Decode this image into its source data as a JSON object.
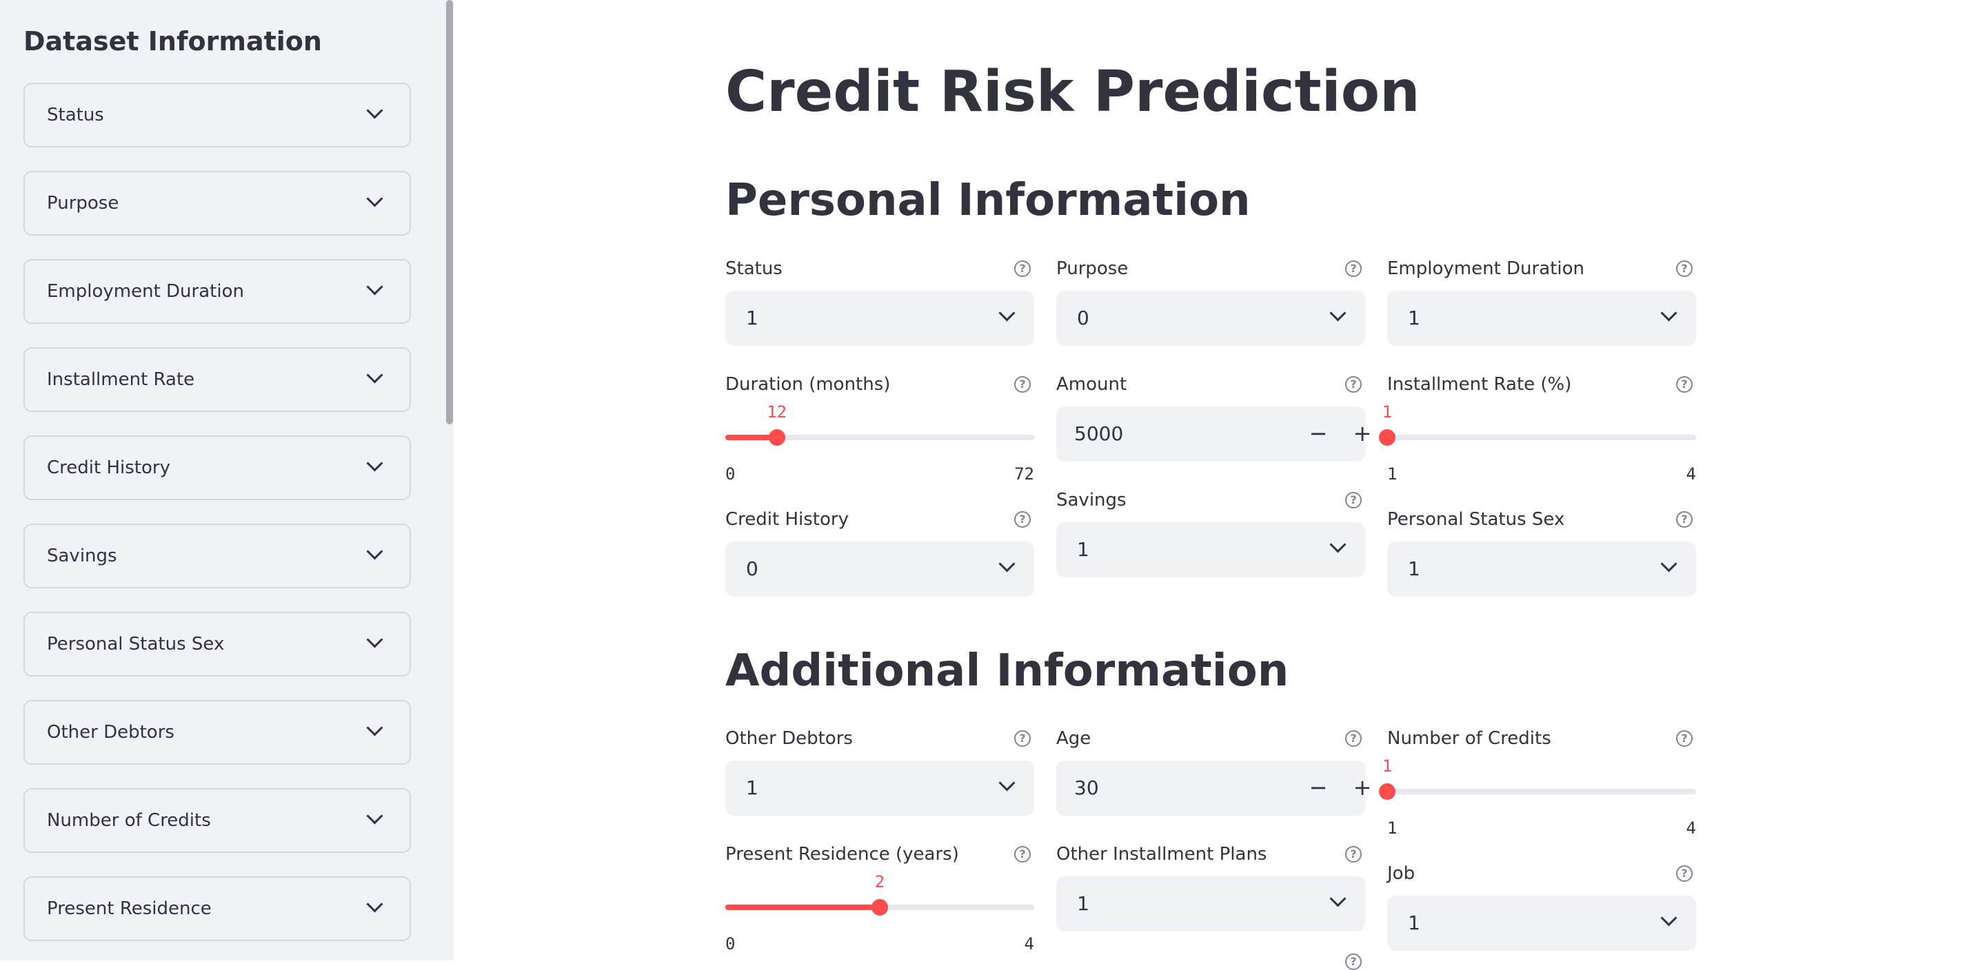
{
  "sidebar": {
    "title": "Dataset Information",
    "expanders": [
      {
        "label": "Status"
      },
      {
        "label": "Purpose"
      },
      {
        "label": "Employment Duration"
      },
      {
        "label": "Installment Rate"
      },
      {
        "label": "Credit History"
      },
      {
        "label": "Savings"
      },
      {
        "label": "Personal Status Sex"
      },
      {
        "label": "Other Debtors"
      },
      {
        "label": "Number of Credits"
      },
      {
        "label": "Present Residence"
      }
    ]
  },
  "main": {
    "title": "Credit Risk Prediction",
    "help_glyph": "?",
    "personal": {
      "heading": "Personal Information",
      "status": {
        "label": "Status",
        "value": "1"
      },
      "purpose": {
        "label": "Purpose",
        "value": "0"
      },
      "employment_duration": {
        "label": "Employment Duration",
        "value": "1"
      },
      "duration": {
        "label": "Duration (months)",
        "value": "12",
        "min": "0",
        "max": "72"
      },
      "amount": {
        "label": "Amount",
        "value": "5000",
        "minus": "−",
        "plus": "+"
      },
      "installment_rate": {
        "label": "Installment Rate (%)",
        "value": "1",
        "min": "1",
        "max": "4"
      },
      "credit_history": {
        "label": "Credit History",
        "value": "0"
      },
      "savings": {
        "label": "Savings",
        "value": "1"
      },
      "personal_status_sex": {
        "label": "Personal Status Sex",
        "value": "1"
      }
    },
    "additional": {
      "heading": "Additional Information",
      "other_debtors": {
        "label": "Other Debtors",
        "value": "1"
      },
      "age": {
        "label": "Age",
        "value": "30",
        "minus": "−",
        "plus": "+"
      },
      "number_of_credits": {
        "label": "Number of Credits",
        "value": "1",
        "min": "1",
        "max": "4"
      },
      "present_residence": {
        "label": "Present Residence (years)",
        "value": "2",
        "min": "0",
        "max": "4"
      },
      "other_installment_plans": {
        "label": "Other Installment Plans",
        "value": "1"
      },
      "job": {
        "label": "Job",
        "value": "1"
      }
    }
  },
  "colors": {
    "accent": "#ff4b4b",
    "sidebar_bg": "#f0f2f6",
    "text": "#31333f"
  }
}
